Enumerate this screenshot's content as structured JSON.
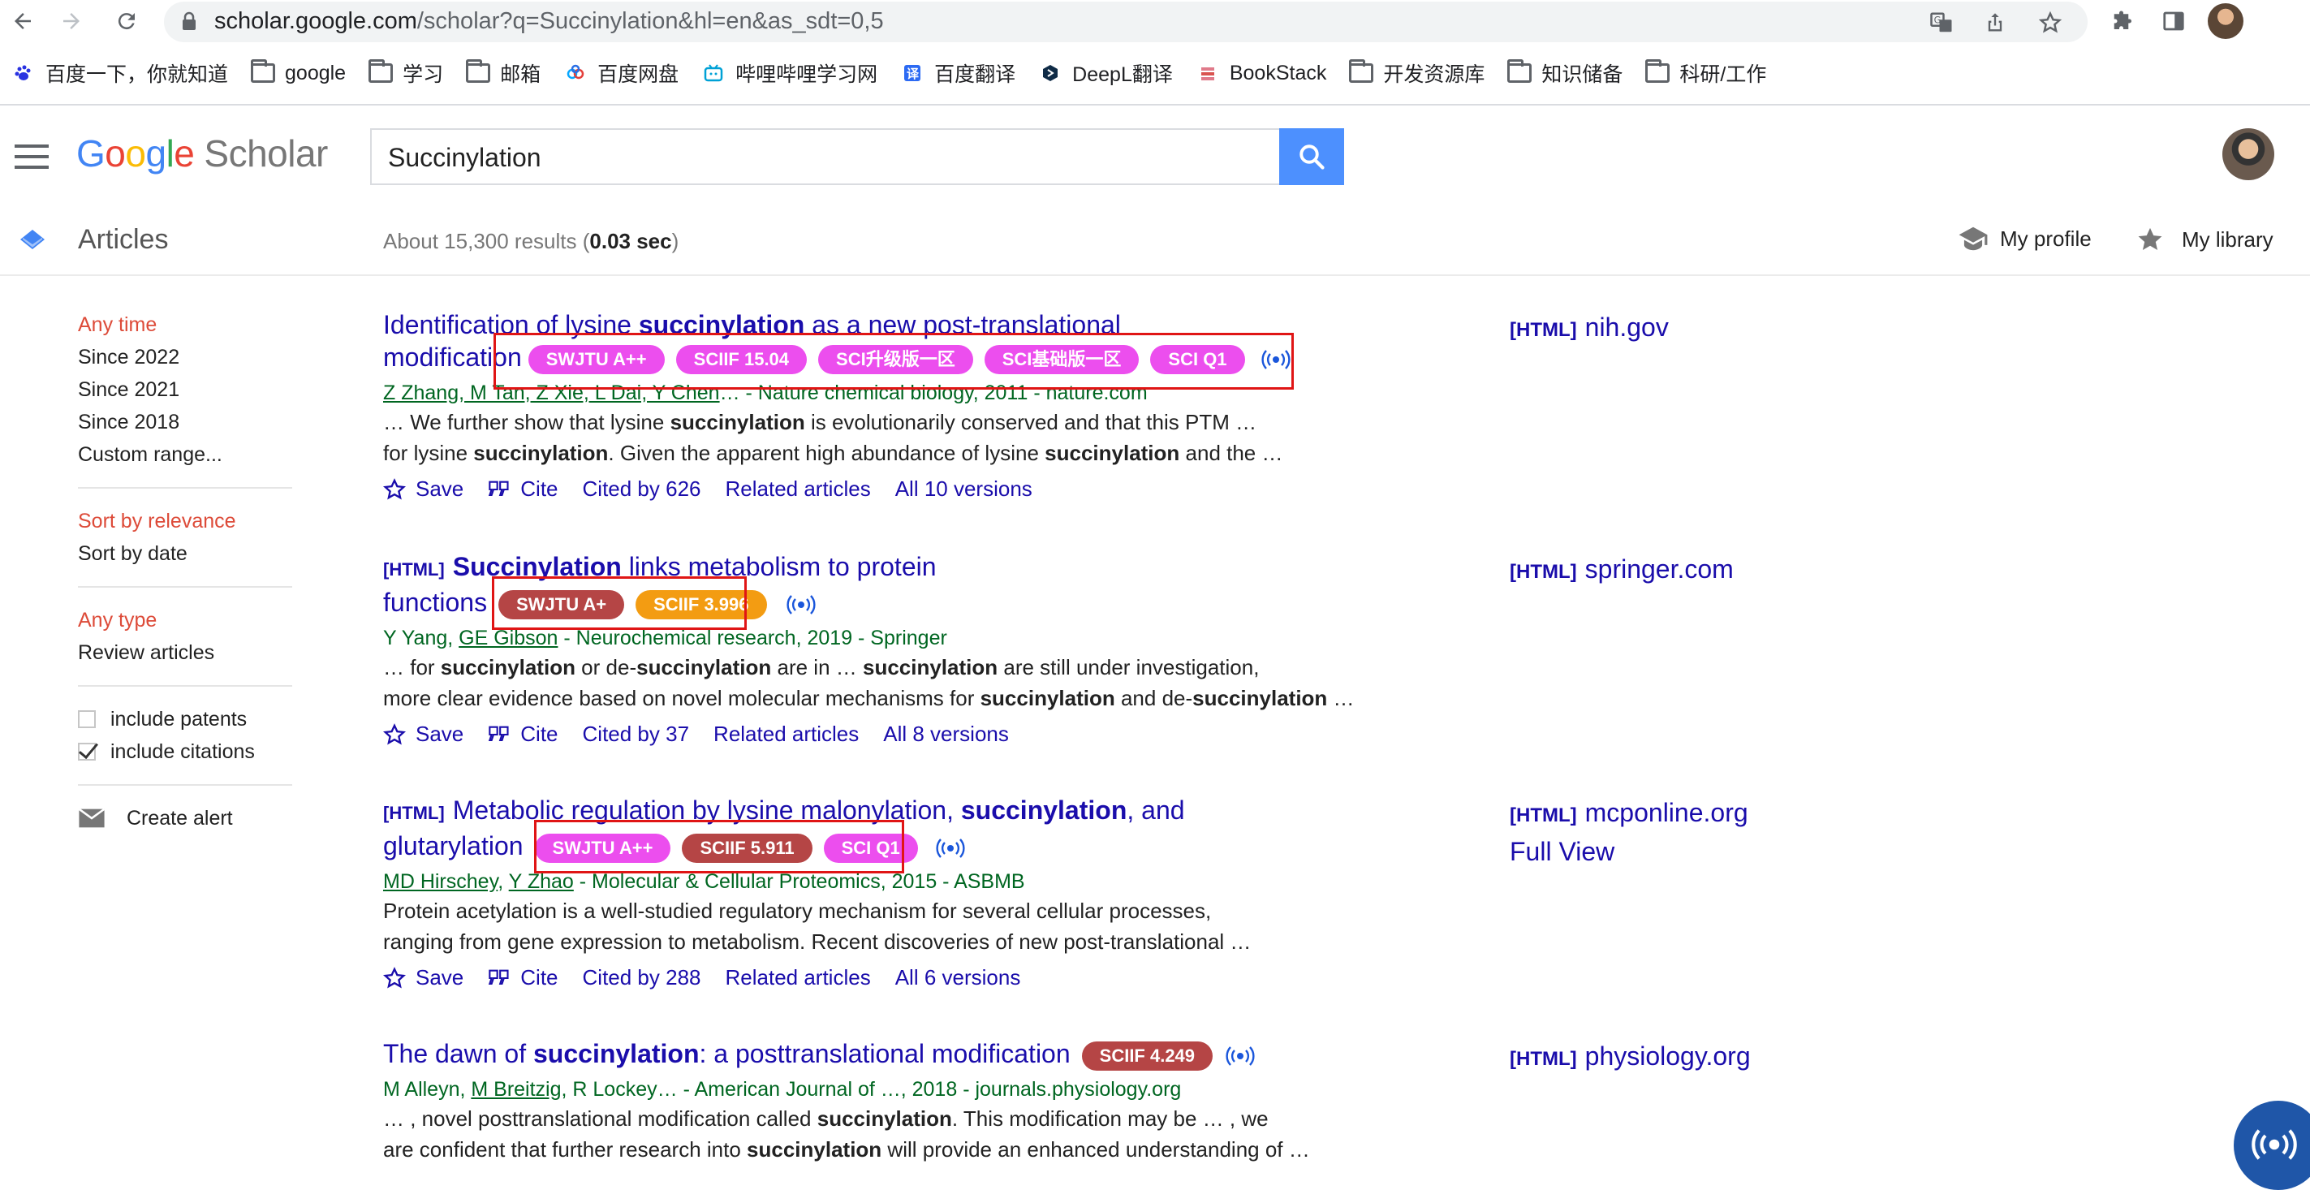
{
  "browser": {
    "url_host": "scholar.google.com",
    "url_rest": "/scholar?q=Succinylation&hl=en&as_sdt=0,5",
    "bookmarks": [
      {
        "label": "百度一下，你就知道",
        "icon": "baidu-paw-icon"
      },
      {
        "label": "google",
        "icon": "folder-icon"
      },
      {
        "label": "学习",
        "icon": "folder-icon"
      },
      {
        "label": "邮箱",
        "icon": "folder-icon"
      },
      {
        "label": "百度网盘",
        "icon": "baidu-netdisk-icon"
      },
      {
        "label": "哔哩哔哩学习网",
        "icon": "bilibili-icon"
      },
      {
        "label": "百度翻译",
        "icon": "baidu-translate-icon"
      },
      {
        "label": "DeepL翻译",
        "icon": "deepl-icon"
      },
      {
        "label": "BookStack",
        "icon": "bookstack-icon"
      },
      {
        "label": "开发资源库",
        "icon": "folder-icon"
      },
      {
        "label": "知识储备",
        "icon": "folder-icon"
      },
      {
        "label": "科研/工作",
        "icon": "folder-icon"
      }
    ]
  },
  "header": {
    "logo_google": "Google",
    "logo_scholar": "Scholar",
    "search_value": "Succinylation"
  },
  "subheader": {
    "section": "Articles",
    "results_prefix": "About 15,300 results (",
    "results_time": "0.03 sec",
    "results_suffix": ")",
    "my_profile": "My profile",
    "my_library": "My library"
  },
  "sidebar": {
    "time_filters": [
      "Any time",
      "Since 2022",
      "Since 2021",
      "Since 2018",
      "Custom range..."
    ],
    "sort_options": [
      "Sort by relevance",
      "Sort by date"
    ],
    "type_filters": [
      "Any type",
      "Review articles"
    ],
    "include_patents": "include patents",
    "include_citations": "include citations",
    "create_alert": "Create alert"
  },
  "results": [
    {
      "title_1": "Identification of lysine ",
      "title_b1": "succinylation",
      "title_2": " as a new post-translational",
      "title_3": "modification",
      "badges": [
        "SWJTU A++",
        "SCIIF 15.04",
        "SCI升级版一区",
        "SCI基础版一区",
        "SCI Q1"
      ],
      "authors": "Z Zhang, M Tan, Z Xie, L Dai, Y Chen",
      "source": "… - Nature chemical biology, 2011 - nature.com",
      "snippet_1a": "… We further show that lysine ",
      "snippet_1b": "succinylation",
      "snippet_1c": " is evolutionarily conserved and that this PTM …",
      "snippet_2a": "for lysine ",
      "snippet_2b": "succinylation",
      "snippet_2c": ". Given the apparent high abundance of lysine ",
      "snippet_2d": "succinylation",
      "snippet_2e": " and the …",
      "save": "Save",
      "cite": "Cite",
      "cited_by": "Cited by 626",
      "related": "Related articles",
      "versions": "All 10 versions",
      "side_tag": "[HTML]",
      "side_domain": "nih.gov"
    },
    {
      "tag": "[HTML]",
      "title_b1": "Succinylation",
      "title_2": " links metabolism to protein",
      "title_3": "functions",
      "badges": [
        "SWJTU A+",
        "SCIIF 3.996"
      ],
      "authors_1": "Y Yang, ",
      "authors_2": "GE Gibson",
      "source": " - Neurochemical research, 2019 - Springer",
      "snippet_1a": "… for ",
      "snippet_1b": "succinylation",
      "snippet_1c": " or de-",
      "snippet_1d": "succinylation",
      "snippet_1e": " are in … ",
      "snippet_1f": "succinylation",
      "snippet_1g": " are still under investigation,",
      "snippet_2a": "more clear evidence based on novel molecular mechanisms for ",
      "snippet_2b": "succinylation",
      "snippet_2c": " and de-",
      "snippet_2d": "succinylation",
      "snippet_2e": " …",
      "save": "Save",
      "cite": "Cite",
      "cited_by": "Cited by 37",
      "related": "Related articles",
      "versions": "All 8 versions",
      "side_tag": "[HTML]",
      "side_domain": "springer.com"
    },
    {
      "tag": "[HTML]",
      "title_1": "Metabolic regulation by lysine malonylation, ",
      "title_b1": "succinylation",
      "title_2": ", and",
      "title_3": "glutarylation",
      "badges": [
        "SWJTU A++",
        "SCIIF 5.911",
        "SCI Q1"
      ],
      "authors_1": "MD Hirschey",
      "authors_2": "Y Zhao",
      "source": " - Molecular & Cellular Proteomics, 2015 - ASBMB",
      "snippet_1": "Protein acetylation is a well-studied regulatory mechanism for several cellular processes,",
      "snippet_2": "ranging from gene expression to metabolism. Recent discoveries of new post-translational …",
      "save": "Save",
      "cite": "Cite",
      "cited_by": "Cited by 288",
      "related": "Related articles",
      "versions": "All 6 versions",
      "side_tag": "[HTML]",
      "side_domain": "mcponline.org",
      "side_extra": "Full View"
    },
    {
      "title_1": "The dawn of ",
      "title_b1": "succinylation",
      "title_2": ": a posttranslational modification",
      "badges": [
        "SCIIF 4.249"
      ],
      "authors_1": "M Alleyn, ",
      "authors_2": "M Breitzig",
      "authors_3": ", R Lockey",
      "source": "… - American Journal of …, 2018 - journals.physiology.org",
      "snippet_1a": "… , novel posttranslational modification called ",
      "snippet_1b": "succinylation",
      "snippet_1c": ". This modification may be … , we",
      "snippet_2a": "are confident that further research into ",
      "snippet_2b": "succinylation",
      "snippet_2c": " will provide an enhanced understanding of …",
      "side_tag": "[HTML]",
      "side_domain": "physiology.org"
    }
  ],
  "colors": {
    "link": "#1a0dab",
    "source_green": "#006621",
    "sidebar_active": "#dd4b39",
    "badge_pink": "#ec4eee",
    "badge_red": "#b54545",
    "badge_orange": "#f39c12",
    "highlight_box": "#e01515",
    "search_button": "#4d90fe"
  }
}
